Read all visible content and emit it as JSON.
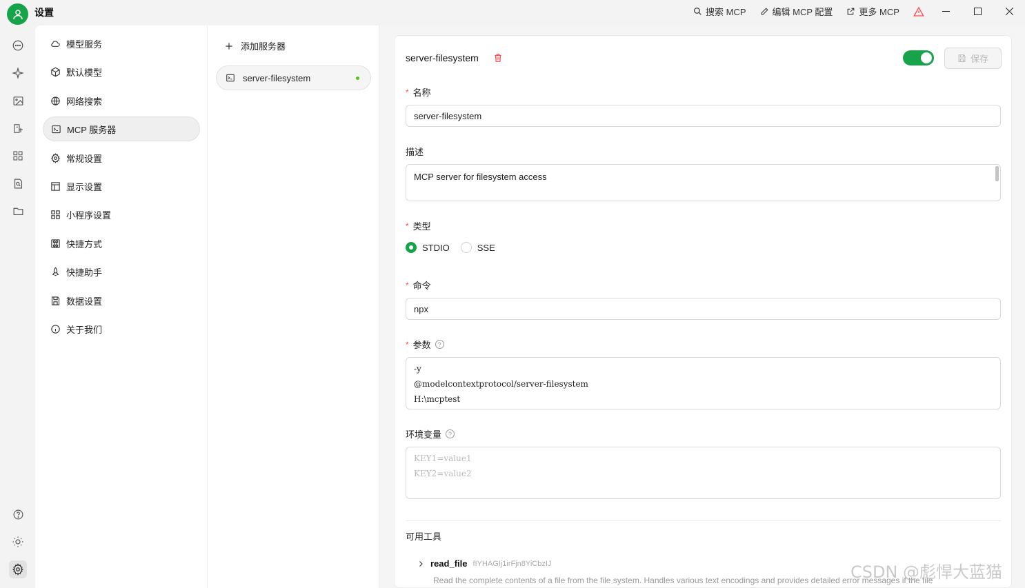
{
  "titlebar": {
    "title": "设置",
    "actions": [
      {
        "label": "搜索 MCP",
        "icon": "search-icon"
      },
      {
        "label": "编辑 MCP 配置",
        "icon": "edit-icon"
      },
      {
        "label": "更多 MCP",
        "icon": "external-link-icon"
      }
    ],
    "warning_icon": "warning-icon"
  },
  "menu": {
    "items": [
      {
        "label": "模型服务",
        "icon": "cloud-icon"
      },
      {
        "label": "默认模型",
        "icon": "cube-icon"
      },
      {
        "label": "网络搜索",
        "icon": "globe-icon"
      },
      {
        "label": "MCP 服务器",
        "icon": "terminal-icon",
        "active": true
      },
      {
        "label": "常规设置",
        "icon": "gear-icon"
      },
      {
        "label": "显示设置",
        "icon": "layout-icon"
      },
      {
        "label": "小程序设置",
        "icon": "grid-icon"
      },
      {
        "label": "快捷方式",
        "icon": "command-icon"
      },
      {
        "label": "快捷助手",
        "icon": "rocket-icon"
      },
      {
        "label": "数据设置",
        "icon": "save-icon"
      },
      {
        "label": "关于我们",
        "icon": "info-icon"
      }
    ]
  },
  "servers": {
    "add_label": "添加服务器",
    "items": [
      {
        "name": "server-filesystem",
        "status_color": "#52c41a"
      }
    ]
  },
  "form": {
    "title": "server-filesystem",
    "enabled": true,
    "save_label": "保存",
    "name_label": "名称",
    "name_value": "server-filesystem",
    "desc_label": "描述",
    "desc_value": "MCP server for filesystem access",
    "type_label": "类型",
    "type_options": [
      "STDIO",
      "SSE"
    ],
    "type_selected": "STDIO",
    "command_label": "命令",
    "command_value": "npx",
    "args_label": "参数",
    "args_lines": [
      "-y",
      "@modelcontextprotocol/server-filesystem",
      "H:\\mcptest"
    ],
    "env_label": "环境变量",
    "env_placeholder_lines": [
      "KEY1=value1",
      "KEY2=value2"
    ]
  },
  "tools": {
    "title": "可用工具",
    "items": [
      {
        "name": "read_file",
        "id": "fIYHAGIj1irFjn8YiCbzIJ",
        "description": "Read the complete contents of a file from the file system. Handles various text encodings and provides detailed error messages if the file"
      }
    ]
  },
  "watermark": "CSDN @彪悍大蓝猫",
  "colors": {
    "accent": "#17a34a",
    "required": "#ff4d4f",
    "danger": "#ff4d4f"
  }
}
